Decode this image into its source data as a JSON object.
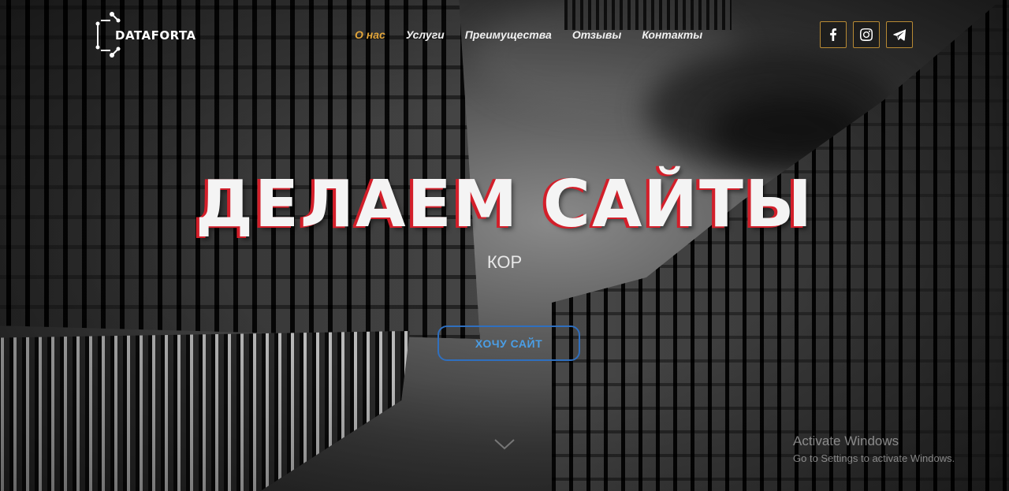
{
  "brand": {
    "name": "DATAFORTA"
  },
  "nav": {
    "items": [
      {
        "label": "О нас",
        "active": true
      },
      {
        "label": "Услуги",
        "active": false
      },
      {
        "label": "Преимущества",
        "active": false
      },
      {
        "label": "Отзывы",
        "active": false
      },
      {
        "label": "Контакты",
        "active": false
      }
    ]
  },
  "socials": [
    {
      "icon": "facebook-icon"
    },
    {
      "icon": "instagram-icon"
    },
    {
      "icon": "telegram-icon"
    }
  ],
  "hero": {
    "title": "ДЕЛАЕМ САЙТЫ",
    "subtitle": "КОР",
    "cta_label": "ХОЧУ САЙТ"
  },
  "watermark": {
    "line1": "Activate Windows",
    "line2": "Go to Settings to activate Windows."
  },
  "colors": {
    "accent_gold": "#e2a53a",
    "title_shadow_red": "#d31f2a",
    "cta_blue": "#2f6fbf"
  }
}
